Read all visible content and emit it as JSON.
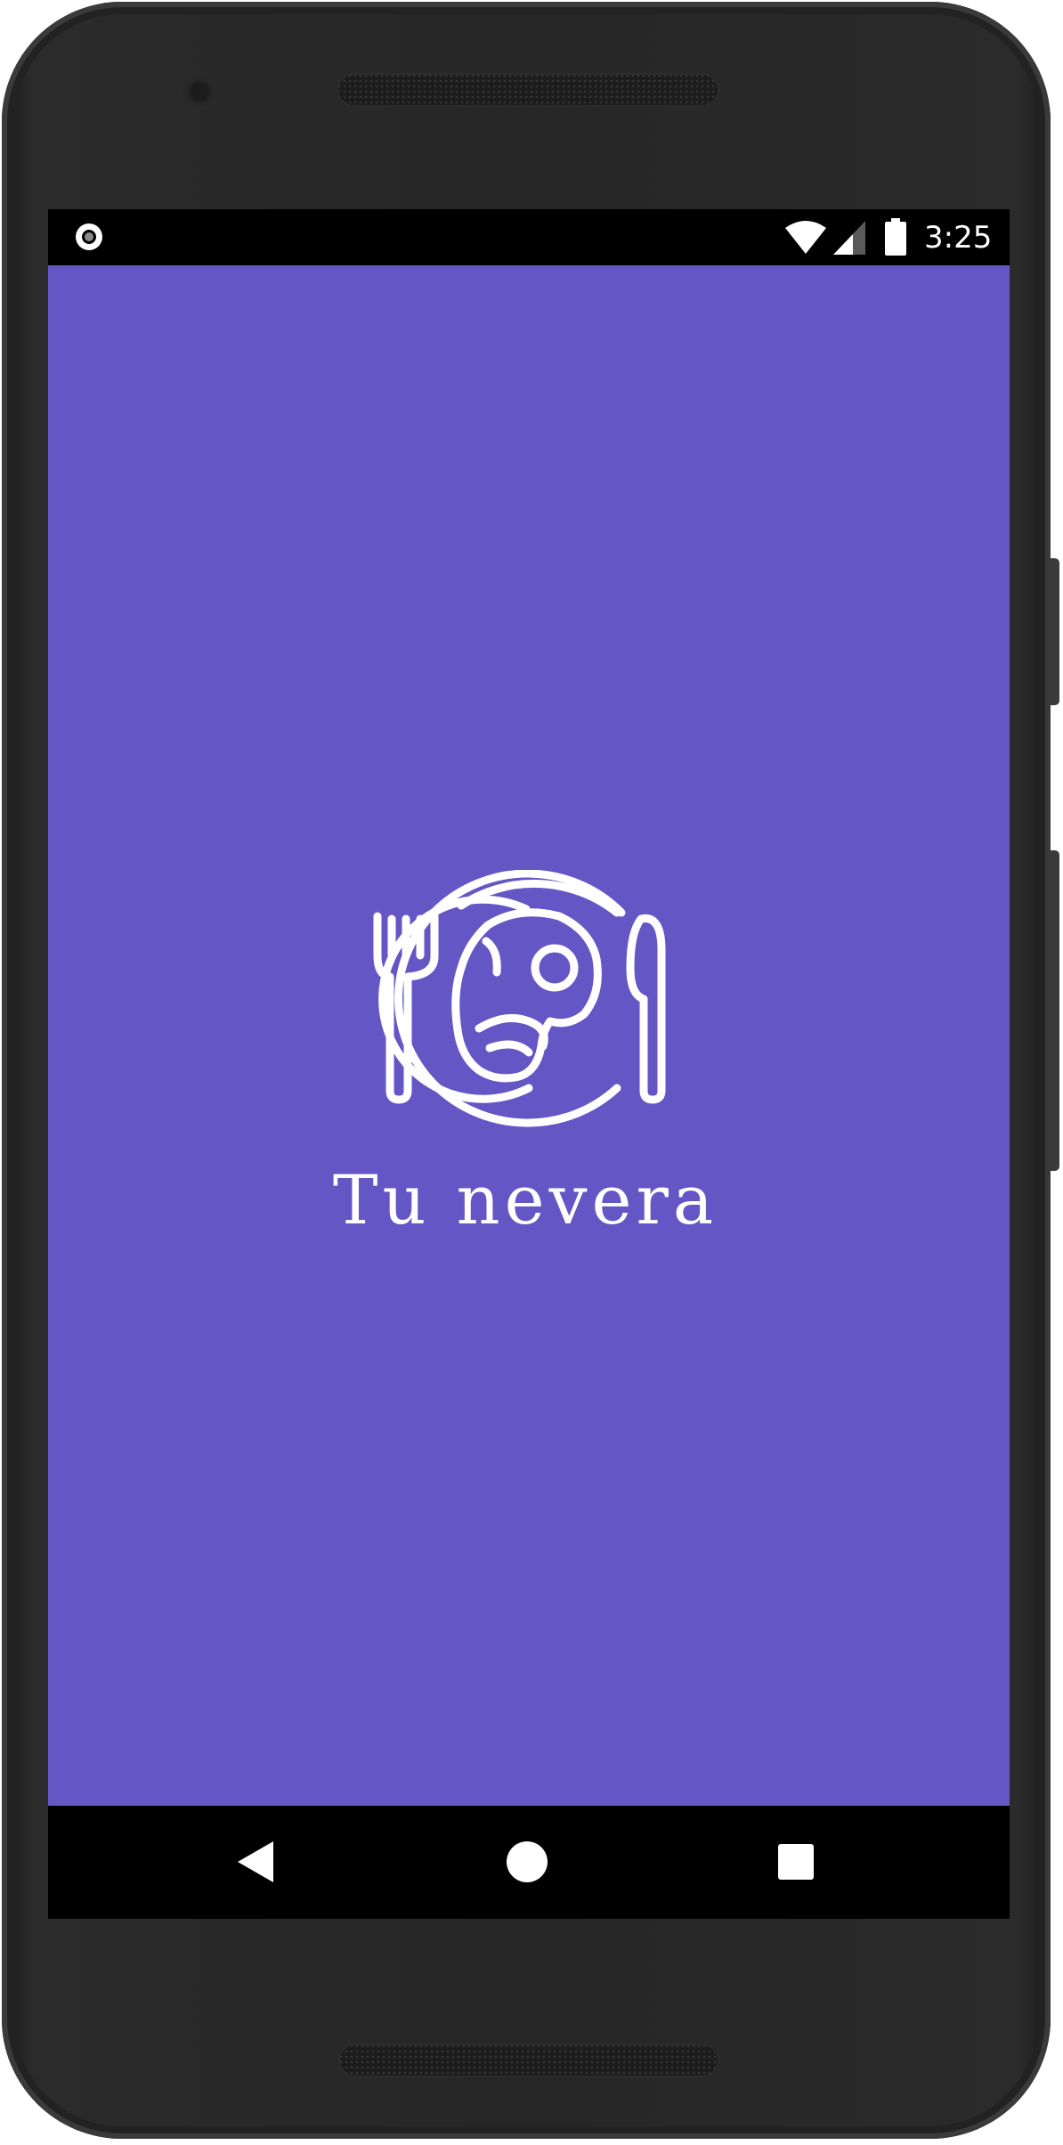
{
  "theme": {
    "primary": "#6556c5",
    "status_bar": "#000000",
    "nav_bar": "#000000",
    "device_frame": "#262626",
    "foreground": "#ffffff"
  },
  "status_bar": {
    "time": "3:25",
    "icons": [
      "record-indicator-icon",
      "wifi-icon",
      "cell-signal-icon",
      "battery-icon"
    ]
  },
  "splash": {
    "logo_icon": "plate-with-steak-fork-knife-icon",
    "app_name": "Tu nevera"
  },
  "nav_bar": {
    "buttons": [
      "back-icon",
      "home-icon",
      "recents-icon"
    ]
  }
}
